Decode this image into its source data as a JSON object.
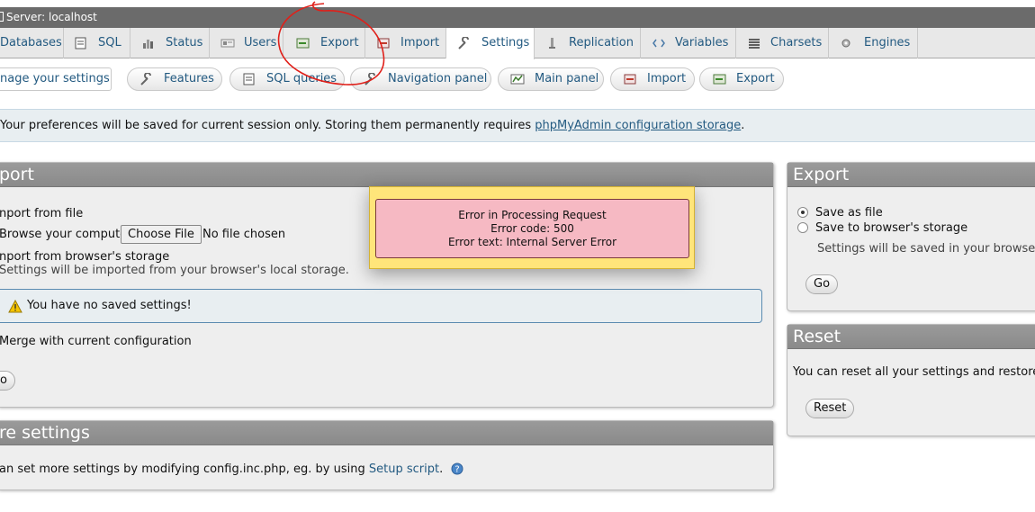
{
  "topbar": {
    "title": "Server: localhost"
  },
  "tabs": [
    {
      "label": "Databases",
      "icon": "databases-icon"
    },
    {
      "label": "SQL",
      "icon": "sql-icon"
    },
    {
      "label": "Status",
      "icon": "status-icon"
    },
    {
      "label": "Users",
      "icon": "users-icon"
    },
    {
      "label": "Export",
      "icon": "export-icon"
    },
    {
      "label": "Import",
      "icon": "import-icon"
    },
    {
      "label": "Settings",
      "icon": "wrench-icon"
    },
    {
      "label": "Replication",
      "icon": "replication-icon"
    },
    {
      "label": "Variables",
      "icon": "variables-icon"
    },
    {
      "label": "Charsets",
      "icon": "charsets-icon"
    },
    {
      "label": "Engines",
      "icon": "engines-icon"
    }
  ],
  "subtabs": [
    {
      "label": "nage your settings"
    },
    {
      "label": "Features",
      "icon": "wrench-icon"
    },
    {
      "label": "SQL queries",
      "icon": "sql-icon"
    },
    {
      "label": "Navigation panel",
      "icon": "navigation-icon"
    },
    {
      "label": "Main panel",
      "icon": "main-panel-icon"
    },
    {
      "label": "Import",
      "icon": "import-icon"
    },
    {
      "label": "Export",
      "icon": "export-icon"
    }
  ],
  "notice": {
    "text": "Your preferences will be saved for current session only. Storing them permanently requires ",
    "link": "phpMyAdmin configuration storage",
    "suffix": "."
  },
  "import_panel": {
    "title": "port",
    "import_from_file": "nport from file",
    "browse_label": "Browse your computer:",
    "choose_file": "Choose File",
    "no_file": "No file chosen",
    "import_from_storage": "nport from browser's storage",
    "storage_note": "Settings will be imported from your browser's local storage.",
    "warning": "You have no saved settings!",
    "merge": "Merge with current configuration",
    "go": "o"
  },
  "more_panel": {
    "title": "re settings",
    "text": "an set more settings by modifying config.inc.php, eg. by using ",
    "link": "Setup script",
    "suffix": "."
  },
  "export_panel": {
    "title": "Export",
    "opt_file": "Save as file",
    "opt_storage": "Save to browser's storage",
    "note": "Settings will be saved in your browser's lo",
    "go": "Go"
  },
  "reset_panel": {
    "title": "Reset",
    "text": "You can reset all your settings and restore ther",
    "button": "Reset"
  },
  "error": {
    "line1": "Error in Processing Request",
    "line2": "Error code: 500",
    "line3": "Error text: Internal Server Error"
  },
  "colors": {
    "link": "#235a81",
    "panel_head": "#8f8f8f",
    "error_bg": "#f6b9c3",
    "error_wrap": "#ffe57a",
    "annotation": "#e0201a"
  }
}
